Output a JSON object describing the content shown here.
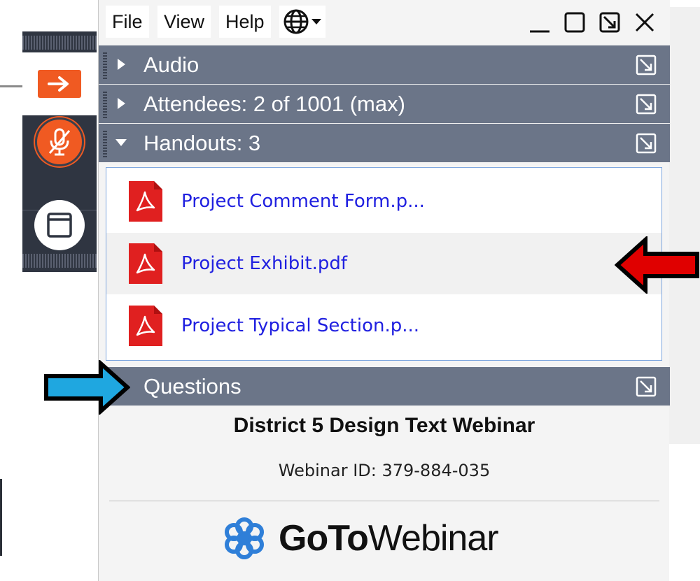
{
  "menubar": {
    "items": [
      "File",
      "View",
      "Help"
    ],
    "language_icon": "globe-dropdown-icon",
    "window_controls": [
      "minimize-icon",
      "maximize-icon",
      "popout-icon",
      "close-icon"
    ]
  },
  "control_bar": {
    "buttons": [
      "show-panel-arrow-icon",
      "muted-microphone-icon",
      "screen-window-icon"
    ],
    "accent_color": "#f05a22"
  },
  "sections": {
    "audio": {
      "label": "Audio",
      "expanded": false
    },
    "attendees": {
      "label": "Attendees:  2 of 1001 (max)",
      "expanded": false
    },
    "handouts": {
      "label": "Handouts: 3",
      "expanded": true
    },
    "questions": {
      "label": "Questions",
      "expanded": false
    }
  },
  "handouts": [
    {
      "name": "Project Comment Form.p...",
      "icon": "pdf-icon"
    },
    {
      "name": "Project Exhibit.pdf",
      "icon": "pdf-icon"
    },
    {
      "name": "Project Typical Section.p...",
      "icon": "pdf-icon"
    }
  ],
  "webinar": {
    "title": "District 5 Design Text Webinar",
    "id_text": "Webinar ID: 379-884-035"
  },
  "brand": {
    "name_bold": "GoTo",
    "name_regular": "Webinar",
    "logo_color": "#2f7fd8"
  },
  "annotations": {
    "red_arrow_color": "#e00000",
    "blue_arrow_color": "#1fa7e0"
  },
  "colors": {
    "section_header": "#6b7588",
    "link": "#2020e0",
    "control_bar": "#2f3541"
  }
}
